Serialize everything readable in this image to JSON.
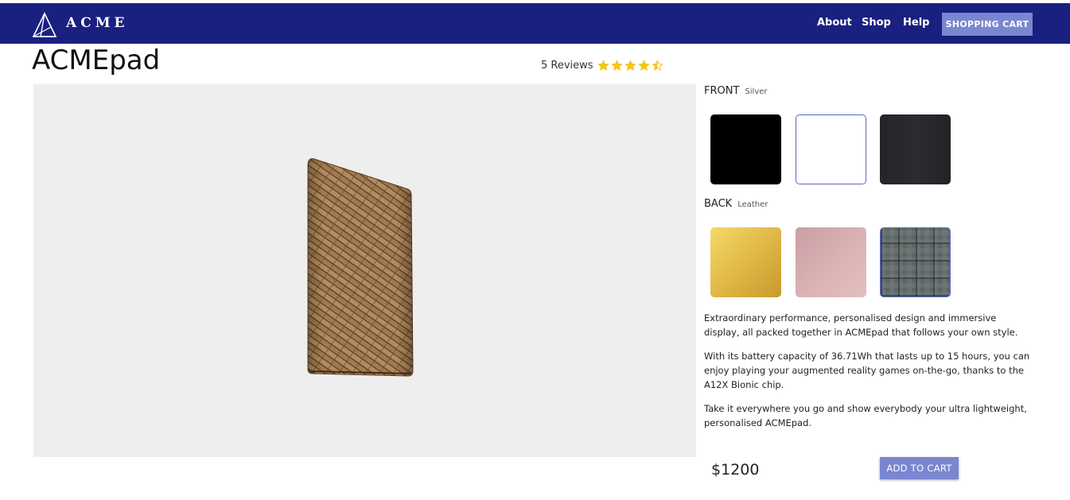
{
  "navbar": {
    "brand": "ACME",
    "logo_icon": "acme-logo-icon",
    "links": [
      "About",
      "Shop",
      "Help"
    ],
    "cart_label": "SHOPPING CART",
    "background": "#1a2080"
  },
  "product": {
    "title": "ACMEpad",
    "reviews_label": "5 Reviews",
    "rating": 4.5,
    "rating_max": 5,
    "star_color": "#f5c518"
  },
  "front": {
    "label": "FRONT",
    "selected": "Silver",
    "swatches": [
      {
        "color": "#000000",
        "selected": false
      },
      {
        "color": "#ffffff",
        "selected": true
      },
      {
        "color": "#26262b",
        "selected": false
      }
    ]
  },
  "back": {
    "label": "BACK",
    "selected": "Leather",
    "swatches": [
      {
        "color": "#e6c04f",
        "selected": false
      },
      {
        "color": "#d4a8aa",
        "selected": false
      },
      {
        "color": "#6b6f72",
        "selected": true
      }
    ]
  },
  "description": [
    "Extraordinary performance, personalised design and immersive display, all packed together in ACMEpad that follows your own style.",
    "With its battery capacity of 36.71Wh that lasts up to 15 hours, you can enjoy playing your augmented reality games on-the-go, thanks to the A12X Bionic chip.",
    "Take it everywhere you go and show everybody your ultra lightweight, personalised ACMEpad."
  ],
  "price": "$1200",
  "add_to_cart_label": "ADD TO CART",
  "accent": "#7a86cf"
}
